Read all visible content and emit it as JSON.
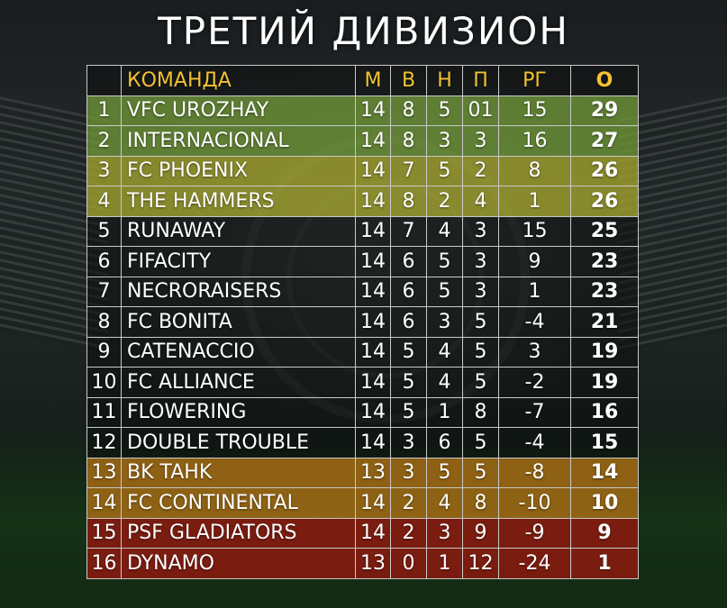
{
  "title": "ТРЕТИЙ ДИВИЗИОН",
  "headers": {
    "pos": "",
    "team": "КОМАНДА",
    "m": "М",
    "w": "В",
    "d": "Н",
    "l": "П",
    "gd": "РГ",
    "pts": "О"
  },
  "colors": {
    "header_text": "#f2c230",
    "promotion": "#6e9637",
    "playoff": "#a0a02d",
    "neutral": "#0c0e0e",
    "relegation_playoff": "#aa6e14",
    "relegation": "#8c190f"
  },
  "rows": [
    {
      "pos": "1",
      "team": "VFC UROZHAY",
      "m": "14",
      "w": "8",
      "d": "5",
      "l": "01",
      "gd": "15",
      "pts": "29",
      "zone": "green"
    },
    {
      "pos": "2",
      "team": "INTERNACIONAL",
      "m": "14",
      "w": "8",
      "d": "3",
      "l": "3",
      "gd": "16",
      "pts": "27",
      "zone": "green"
    },
    {
      "pos": "3",
      "team": "FC PHOENIX",
      "m": "14",
      "w": "7",
      "d": "5",
      "l": "2",
      "gd": "8",
      "pts": "26",
      "zone": "yellow"
    },
    {
      "pos": "4",
      "team": "THE HAMMERS",
      "m": "14",
      "w": "8",
      "d": "2",
      "l": "4",
      "gd": "1",
      "pts": "26",
      "zone": "yellow"
    },
    {
      "pos": "5",
      "team": "RUNAWAY",
      "m": "14",
      "w": "7",
      "d": "4",
      "l": "3",
      "gd": "15",
      "pts": "25",
      "zone": "dark"
    },
    {
      "pos": "6",
      "team": "FIFACITY",
      "m": "14",
      "w": "6",
      "d": "5",
      "l": "3",
      "gd": "9",
      "pts": "23",
      "zone": "dark"
    },
    {
      "pos": "7",
      "team": "NECRORAISERS",
      "m": "14",
      "w": "6",
      "d": "5",
      "l": "3",
      "gd": "1",
      "pts": "23",
      "zone": "dark"
    },
    {
      "pos": "8",
      "team": "FC BONITA",
      "m": "14",
      "w": "6",
      "d": "3",
      "l": "5",
      "gd": "-4",
      "pts": "21",
      "zone": "dark"
    },
    {
      "pos": "9",
      "team": "CATENACCIO",
      "m": "14",
      "w": "5",
      "d": "4",
      "l": "5",
      "gd": "3",
      "pts": "19",
      "zone": "dark"
    },
    {
      "pos": "10",
      "team": "FC ALLIANCE",
      "m": "14",
      "w": "5",
      "d": "4",
      "l": "5",
      "gd": "-2",
      "pts": "19",
      "zone": "dark"
    },
    {
      "pos": "11",
      "team": "FLOWERING",
      "m": "14",
      "w": "5",
      "d": "1",
      "l": "8",
      "gd": "-7",
      "pts": "16",
      "zone": "dark"
    },
    {
      "pos": "12",
      "team": "DOUBLE TROUBLE",
      "m": "14",
      "w": "3",
      "d": "6",
      "l": "5",
      "gd": "-4",
      "pts": "15",
      "zone": "dark"
    },
    {
      "pos": "13",
      "team": "BK TAHK",
      "m": "13",
      "w": "3",
      "d": "5",
      "l": "5",
      "gd": "-8",
      "pts": "14",
      "zone": "orange"
    },
    {
      "pos": "14",
      "team": "FC CONTINENTAL",
      "m": "14",
      "w": "2",
      "d": "4",
      "l": "8",
      "gd": "-10",
      "pts": "10",
      "zone": "orange"
    },
    {
      "pos": "15",
      "team": "PSF GLADIATORS",
      "m": "14",
      "w": "2",
      "d": "3",
      "l": "9",
      "gd": "-9",
      "pts": "9",
      "zone": "red"
    },
    {
      "pos": "16",
      "team": "DYNAMO",
      "m": "13",
      "w": "0",
      "d": "1",
      "l": "12",
      "gd": "-24",
      "pts": "1",
      "zone": "red"
    }
  ]
}
